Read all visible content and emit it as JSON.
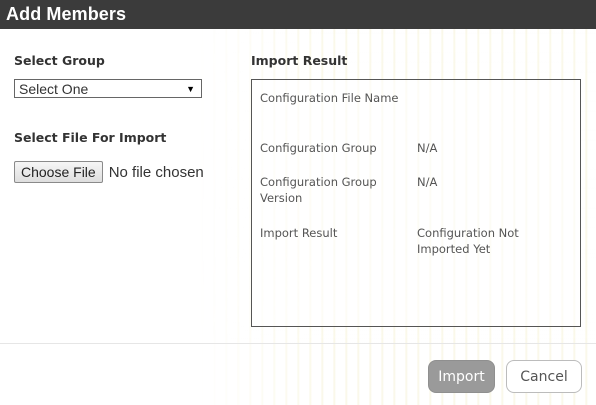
{
  "dialog": {
    "title": "Add Members"
  },
  "select_group": {
    "label": "Select Group",
    "selected": "Select One",
    "icon": "chevron-down-icon"
  },
  "file_import": {
    "label": "Select File For Import",
    "button_label": "Choose File",
    "status": "No file chosen"
  },
  "import_result": {
    "label": "Import Result",
    "rows": [
      {
        "key": "Configuration File Name",
        "value": ""
      },
      {
        "key": "Configuration Group",
        "value": "N/A"
      },
      {
        "key": "Configuration Group Version",
        "value": "N/A"
      },
      {
        "key": "Import Result",
        "value": "Configuration Not Imported Yet"
      }
    ]
  },
  "footer": {
    "import_label": "Import",
    "cancel_label": "Cancel"
  },
  "colors": {
    "title_bar": "#3b3b3b",
    "import_button": "#9a9a9a",
    "background_rain": "#e2d678"
  }
}
